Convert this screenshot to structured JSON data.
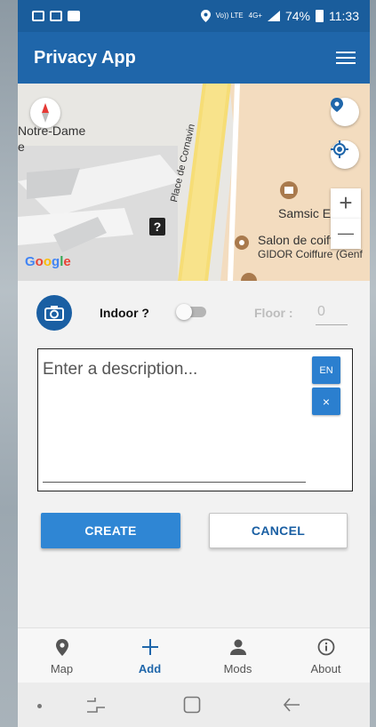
{
  "status_bar": {
    "network": "Vo)) LTE",
    "network_type": "4G+",
    "battery": "74%",
    "time": "11:33"
  },
  "app_bar": {
    "title": "Privacy App",
    "menu_icon": "hamburger-icon"
  },
  "map": {
    "labels": {
      "notre_dame": "Notre-Dame",
      "notre_dame_cont": "e",
      "street": "Place de Cornavin",
      "samsic": "Samsic Emploi",
      "salon": "Salon de coiffure",
      "gidor": "GIDOR Coiffure (Genf"
    },
    "attribution": [
      "G",
      "o",
      "o",
      "g",
      "l",
      "e"
    ],
    "zoom_in": "+",
    "zoom_out": "—"
  },
  "form": {
    "indoor_label": "Indoor ?",
    "indoor_on": false,
    "floor_label": "Floor :",
    "floor_value": "0",
    "description_placeholder": "Enter a description...",
    "lang_button": "EN",
    "clear_button": "×",
    "create_label": "CREATE",
    "cancel_label": "CANCEL"
  },
  "tabs": [
    {
      "label": "Map",
      "icon": "map-pin-icon",
      "active": false
    },
    {
      "label": "Add",
      "icon": "plus-icon",
      "active": true
    },
    {
      "label": "Mods",
      "icon": "person-icon",
      "active": false
    },
    {
      "label": "About",
      "icon": "info-icon",
      "active": false
    }
  ],
  "colors": {
    "primary": "#1f66aa",
    "status_bar": "#1a5d9c",
    "button": "#2f86d4"
  }
}
